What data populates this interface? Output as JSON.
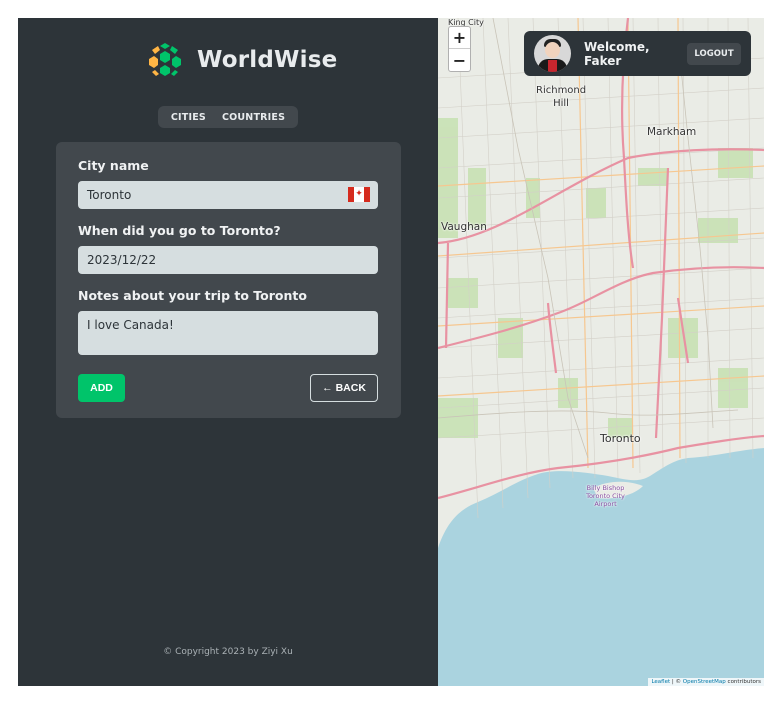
{
  "app": {
    "name": "WorldWise"
  },
  "nav": {
    "cities": "CITIES",
    "countries": "COUNTRIES"
  },
  "form": {
    "city_label": "City name",
    "city_value": "Toronto",
    "flag_emoji": "🇨🇦",
    "date_label": "When did you go to Toronto?",
    "date_value": "2023/12/22",
    "notes_label": "Notes about your trip to Toronto",
    "notes_value": "I love Canada!",
    "add_label": "ADD",
    "back_label": "BACK",
    "back_arrow": "←"
  },
  "footer": {
    "text": "© Copyright 2023 by Ziyi Xu"
  },
  "map": {
    "zoom_in": "+",
    "zoom_out": "−",
    "labels": {
      "king_city": "King City",
      "richmond_hill": "Richmond Hill",
      "markham": "Markham",
      "vaughan": "Vaughan",
      "toronto": "Toronto",
      "airport": "Billy Bishop Toronto City Airport"
    },
    "attribution": {
      "leaflet": "Leaflet",
      "sep": " | © ",
      "osm": "OpenStreetMap",
      "contrib": " contributors"
    },
    "colors": {
      "land": "#eaece6",
      "water": "#aad3df",
      "park": "#c8e2b4",
      "highway": "#e892a2"
    }
  },
  "user": {
    "welcome": "Welcome, Faker",
    "logout": "LOGOUT"
  },
  "colors": {
    "sidebar": "#2d3439",
    "panel": "#42484d",
    "accent": "#00c46a",
    "input": "#d6dee0"
  }
}
